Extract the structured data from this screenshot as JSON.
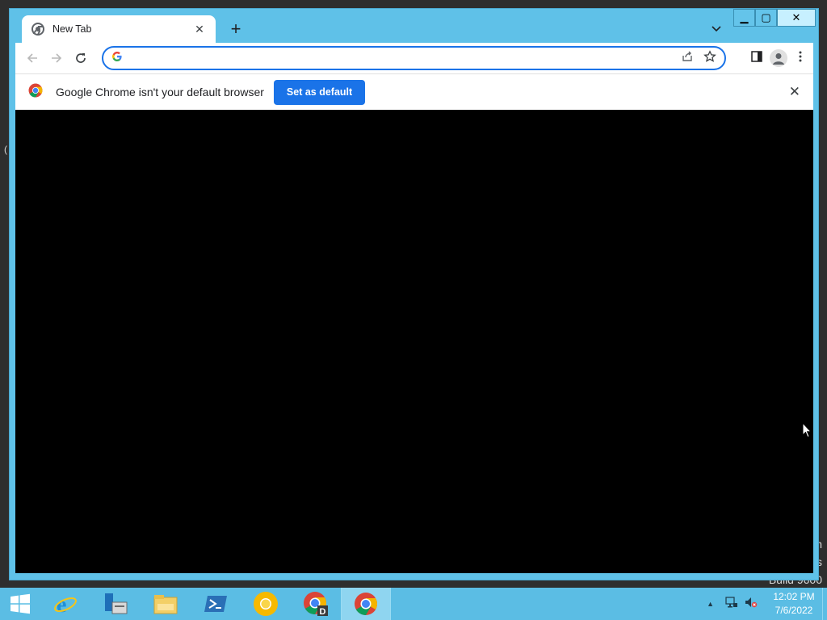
{
  "browser": {
    "tab": {
      "title": "New Tab",
      "close_glyph": "✕"
    },
    "new_tab_glyph": "+",
    "omnibox": {
      "value": "",
      "placeholder": ""
    },
    "infobar": {
      "message": "Google Chrome isn't your default browser",
      "button_label": "Set as default",
      "dismiss_glyph": "✕"
    },
    "content_background": "#000000"
  },
  "window_controls": {
    "minimize": "▁",
    "maximize": "▢",
    "close": "✕"
  },
  "desktop": {
    "watermark_lines": [
      "n",
      "s",
      "Build 9600"
    ],
    "left_edge_char": "("
  },
  "taskbar": {
    "items": [
      {
        "name": "start-icon"
      },
      {
        "name": "internet-explorer-icon"
      },
      {
        "name": "server-manager-icon"
      },
      {
        "name": "file-explorer-icon"
      },
      {
        "name": "powershell-icon"
      },
      {
        "name": "chrome-canary-icon"
      },
      {
        "name": "chrome-dev-icon"
      },
      {
        "name": "chrome-icon"
      }
    ],
    "clock": {
      "time": "12:02 PM",
      "date": "7/6/2022"
    }
  },
  "colors": {
    "window_frame": "#5fc1e8",
    "accent": "#1a73e8",
    "taskbar": "#5bbde4"
  }
}
